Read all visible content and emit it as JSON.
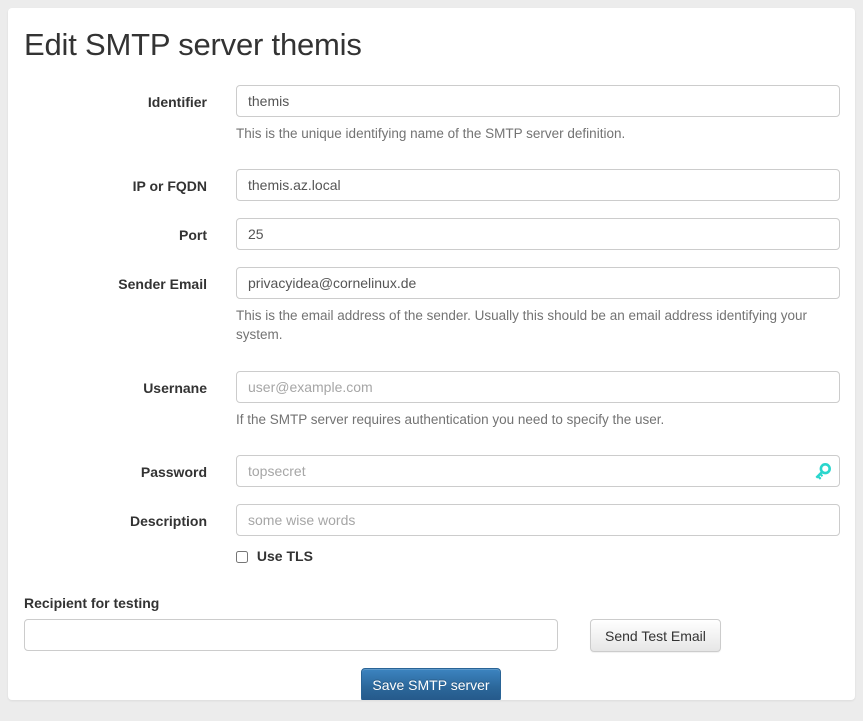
{
  "page": {
    "title": "Edit SMTP server themis"
  },
  "form": {
    "fields": [
      {
        "name": "identifier",
        "label": "Identifier",
        "value": "themis",
        "placeholder": "",
        "help": "This is the unique identifying name of the SMTP server definition."
      },
      {
        "name": "ip-or-fqdn",
        "label": "IP or FQDN",
        "value": "themis.az.local",
        "placeholder": "",
        "help": ""
      },
      {
        "name": "port",
        "label": "Port",
        "value": "25",
        "placeholder": "",
        "help": ""
      },
      {
        "name": "sender-email",
        "label": "Sender Email",
        "value": "privacyidea@cornelinux.de",
        "placeholder": "",
        "help": "This is the email address of the sender. Usually this should be an email address identifying your system."
      },
      {
        "name": "username",
        "label": "Usernane",
        "value": "",
        "placeholder": "user@example.com",
        "help": "If the SMTP server requires authentication you need to specify the user."
      },
      {
        "name": "password",
        "label": "Password",
        "value": "",
        "placeholder": "topsecret",
        "help": ""
      },
      {
        "name": "description",
        "label": "Description",
        "value": "",
        "placeholder": "some wise words",
        "help": ""
      }
    ],
    "tls": {
      "label": "Use TLS",
      "checked": false
    },
    "recipient": {
      "label": "Recipient for testing",
      "value": "",
      "placeholder": ""
    }
  },
  "buttons": {
    "send_test_email": "Send Test Email",
    "save": "Save SMTP server"
  },
  "icons": {
    "password_key": "key-icon"
  },
  "colors": {
    "page_background": "#ececec",
    "card_background": "#ffffff",
    "primary_button": "#2b6699",
    "key_icon": "#2ad6cd",
    "help_text": "#737373",
    "input_border": "#cccccc"
  }
}
